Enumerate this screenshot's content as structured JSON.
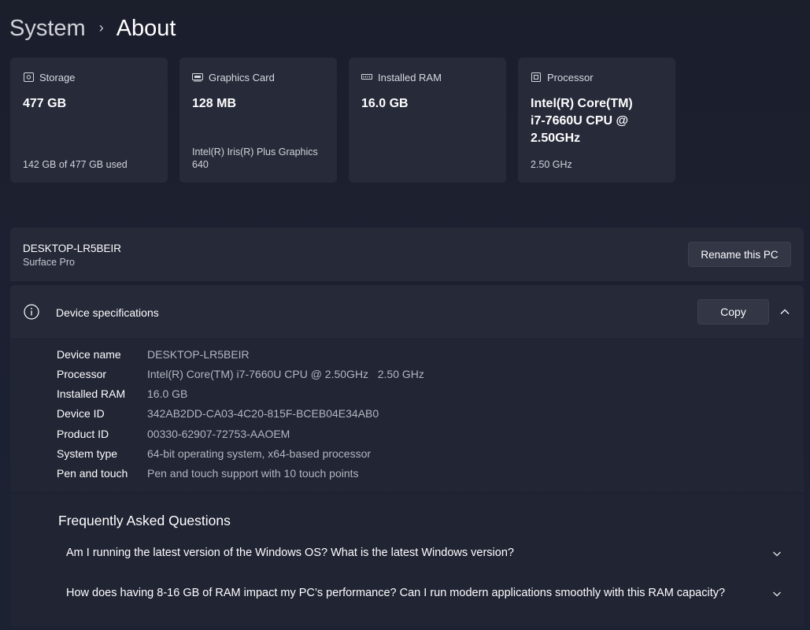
{
  "breadcrumb": {
    "parent": "System",
    "separator": "›",
    "current": "About"
  },
  "cards": [
    {
      "icon": "storage-icon",
      "label": "Storage",
      "value": "477 GB",
      "sub": "142 GB of 477 GB used"
    },
    {
      "icon": "graphics-card-icon",
      "label": "Graphics Card",
      "value": "128 MB",
      "sub": "Intel(R) Iris(R) Plus Graphics 640"
    },
    {
      "icon": "ram-icon",
      "label": "Installed RAM",
      "value": "16.0 GB",
      "sub": ""
    },
    {
      "icon": "processor-icon",
      "label": "Processor",
      "value": "Intel(R) Core(TM) i7-7660U CPU @ 2.50GHz",
      "sub": "2.50 GHz"
    }
  ],
  "pc": {
    "name": "DESKTOP-LR5BEIR",
    "model": "Surface Pro",
    "rename_label": "Rename this PC"
  },
  "specs": {
    "title": "Device specifications",
    "copy_label": "Copy",
    "rows": [
      {
        "label": "Device name",
        "value": "DESKTOP-LR5BEIR"
      },
      {
        "label": "Processor",
        "value": "Intel(R) Core(TM) i7-7660U CPU @ 2.50GHz   2.50 GHz"
      },
      {
        "label": "Installed RAM",
        "value": "16.0 GB"
      },
      {
        "label": "Device ID",
        "value": "342AB2DD-CA03-4C20-815F-BCEB04E34AB0"
      },
      {
        "label": "Product ID",
        "value": "00330-62907-72753-AAOEM"
      },
      {
        "label": "System type",
        "value": "64-bit operating system, x64-based processor"
      },
      {
        "label": "Pen and touch",
        "value": "Pen and touch support with 10 touch points"
      }
    ]
  },
  "faq": {
    "title": "Frequently Asked Questions",
    "items": [
      {
        "question": "Am I running the latest version of the Windows OS? What is the latest Windows version?"
      },
      {
        "question": "How does having 8-16 GB of RAM impact my PC’s performance? Can I run modern applications smoothly with this RAM capacity?"
      }
    ]
  }
}
